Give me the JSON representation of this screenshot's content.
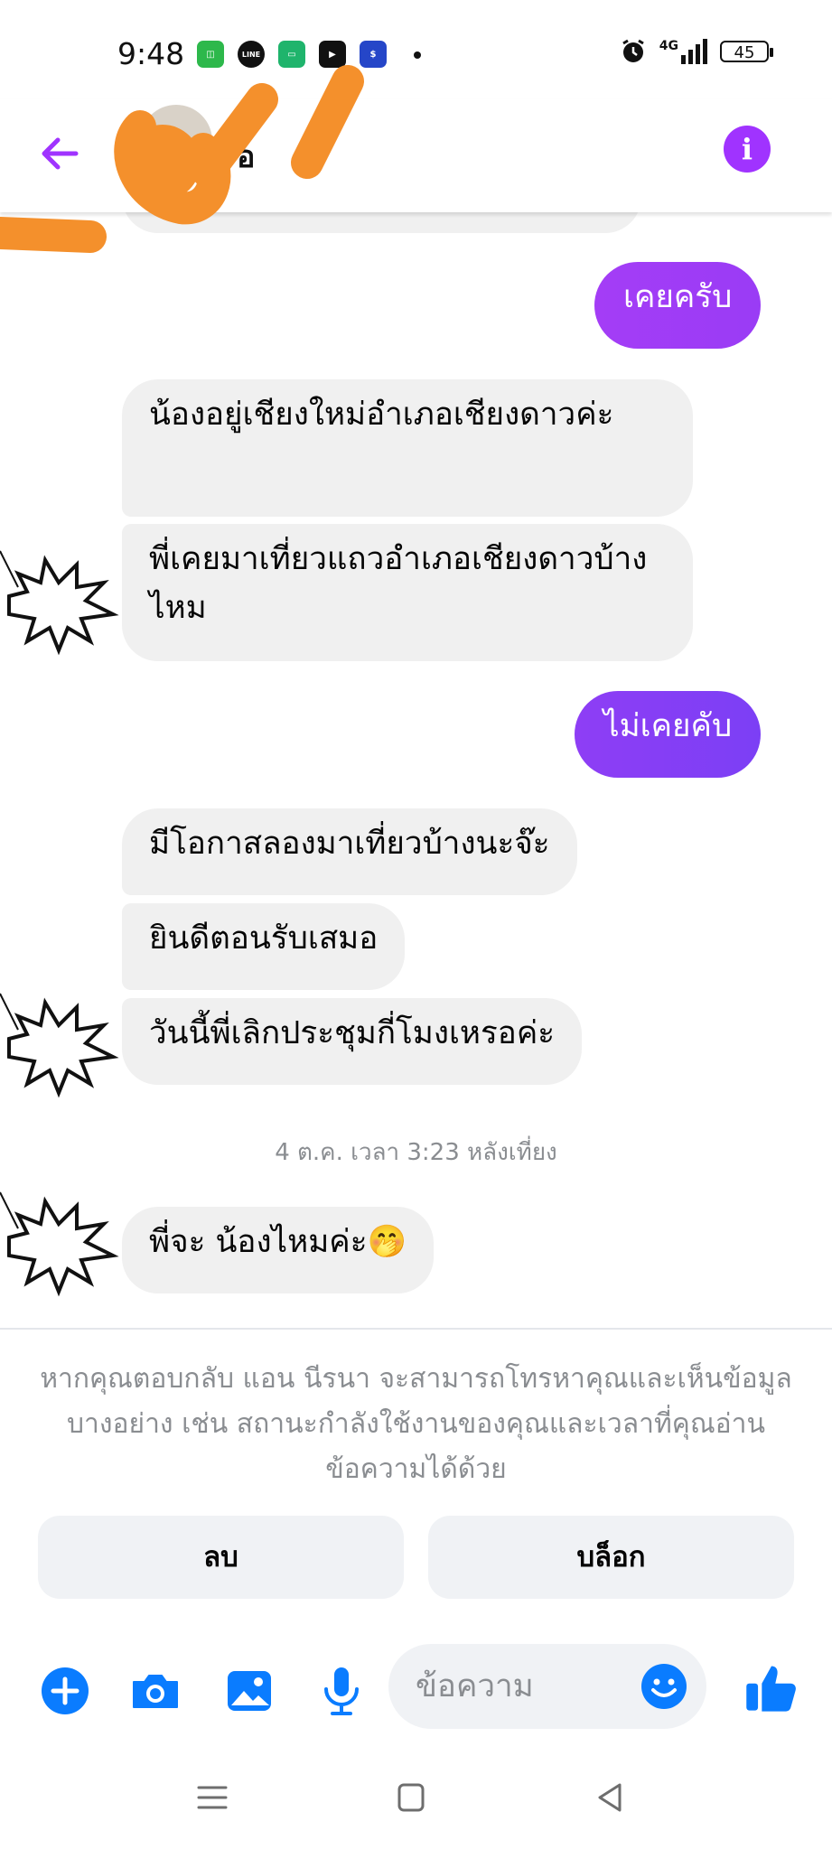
{
  "status_bar": {
    "time": "9:48",
    "network": "4G",
    "battery": "45"
  },
  "header": {
    "contact_name": "อ",
    "back_icon": "arrow-left-icon",
    "info_icon": "info-icon",
    "info_glyph": "i"
  },
  "messages": [
    {
      "direction": "sent",
      "text": "เคยครับ"
    },
    {
      "direction": "received",
      "text": "น้องอยู่เชียงใหม่อำเภอเชียงดาวค่ะ"
    },
    {
      "direction": "received",
      "text": "พี่เคยมาเที่ยวแถวอำเภอเชียงดาวบ้างไหม"
    },
    {
      "direction": "sent",
      "text": "ไม่เคยคับ"
    },
    {
      "direction": "received",
      "text": "มีโอกาสลองมาเที่ยวบ้างนะจ๊ะ"
    },
    {
      "direction": "received",
      "text": "ยินดีตอนรับเสมอ"
    },
    {
      "direction": "received",
      "text": "วันนี้พี่เลิกประชุมกี่โมงเหรอค่ะ"
    },
    {
      "direction": "received",
      "text": "พี่จะ น้องไหมค่ะ🤭"
    }
  ],
  "timestamp": "4 ต.ค. เวลา 3:23 หลังเที่ยง",
  "notice": "หากคุณตอบกลับ แอน นีรนา จะสามารถโทรหาคุณและเห็นข้อมูลบางอย่าง เช่น สถานะกำลังใช้งานของคุณและเวลาที่คุณอ่านข้อความได้ด้วย",
  "actions": {
    "delete_label": "ลบ",
    "block_label": "บล็อก"
  },
  "composer": {
    "placeholder": "ข้อความ",
    "icons": [
      "plus-icon",
      "camera-icon",
      "image-icon",
      "microphone-icon",
      "emoji-icon",
      "thumbs-up-icon"
    ]
  },
  "navigation": {
    "icons": [
      "menu-icon",
      "home-icon",
      "back-icon"
    ]
  },
  "colors": {
    "accent_purple": "#a033ff",
    "sent_gradient_start": "#a43df6",
    "sent_gradient_end": "#7c3ff5",
    "messenger_blue": "#0a7cff",
    "bubble_gray": "#f0f0f0",
    "scribble_orange": "#f4902c"
  }
}
